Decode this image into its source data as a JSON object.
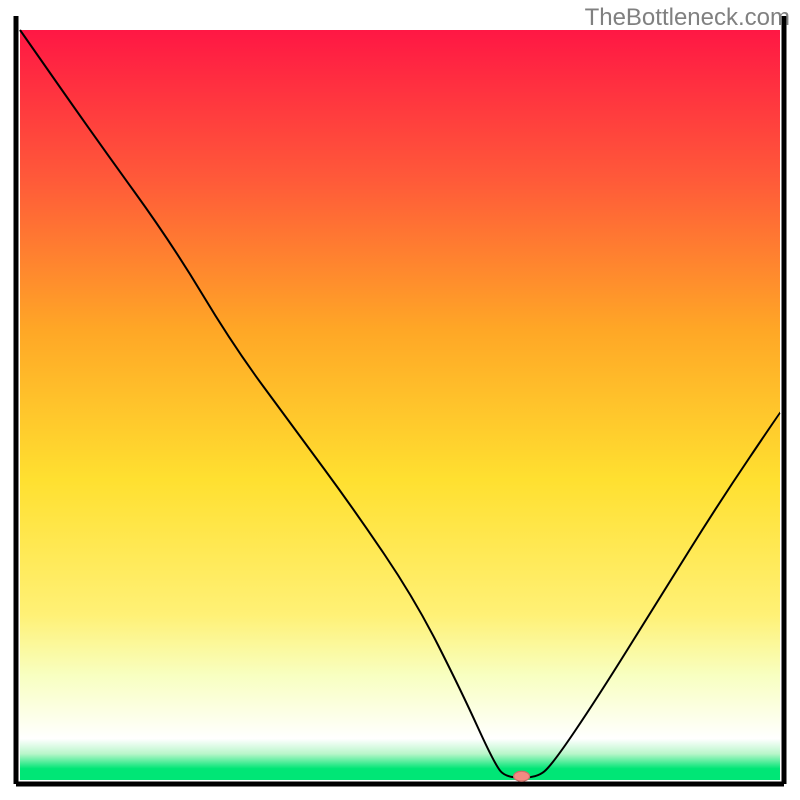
{
  "watermark": "TheBottleneck.com",
  "chart_data": {
    "type": "line",
    "title": "",
    "xlabel": "",
    "ylabel": "",
    "xlim": [
      0,
      100
    ],
    "ylim": [
      0,
      100
    ],
    "grid": false,
    "legend": false,
    "background_gradient": {
      "stops": [
        {
          "offset": 0.0,
          "color": "#ff1744"
        },
        {
          "offset": 0.2,
          "color": "#ff5a39"
        },
        {
          "offset": 0.4,
          "color": "#ffa726"
        },
        {
          "offset": 0.6,
          "color": "#ffe030"
        },
        {
          "offset": 0.78,
          "color": "#fff176"
        },
        {
          "offset": 0.86,
          "color": "#f8ffc0"
        },
        {
          "offset": 0.945,
          "color": "#ffffff"
        },
        {
          "offset": 0.965,
          "color": "#b9f6ca"
        },
        {
          "offset": 0.985,
          "color": "#00e676"
        }
      ]
    },
    "series": [
      {
        "name": "bottleneck-curve",
        "color": "#000000",
        "stroke_width": 2,
        "points": [
          {
            "x": 0.0,
            "y": 100.0
          },
          {
            "x": 10.0,
            "y": 85.5
          },
          {
            "x": 20.0,
            "y": 71.5
          },
          {
            "x": 28.0,
            "y": 58.0
          },
          {
            "x": 36.0,
            "y": 47.0
          },
          {
            "x": 44.0,
            "y": 36.0
          },
          {
            "x": 52.0,
            "y": 24.0
          },
          {
            "x": 58.0,
            "y": 12.0
          },
          {
            "x": 62.5,
            "y": 2.0
          },
          {
            "x": 64.0,
            "y": 0.3
          },
          {
            "x": 68.0,
            "y": 0.3
          },
          {
            "x": 70.0,
            "y": 2.0
          },
          {
            "x": 76.0,
            "y": 11.0
          },
          {
            "x": 84.0,
            "y": 24.0
          },
          {
            "x": 92.0,
            "y": 37.0
          },
          {
            "x": 100.0,
            "y": 49.0
          }
        ]
      }
    ],
    "marker": {
      "name": "sweet-spot-marker",
      "x": 66.0,
      "y": 0.5,
      "fill": "#f28b82",
      "stroke": "#c96f69",
      "rx": 8,
      "ry": 5
    },
    "axes": {
      "left": {
        "x0": 2,
        "y0": 2,
        "x1": 2,
        "y1": 98,
        "width": 5
      },
      "right": {
        "x0": 98,
        "y0": 2,
        "x1": 98,
        "y1": 98,
        "width": 5
      },
      "bottom": {
        "x0": 2,
        "y0": 98,
        "x1": 98,
        "y1": 98,
        "width": 5
      }
    }
  }
}
